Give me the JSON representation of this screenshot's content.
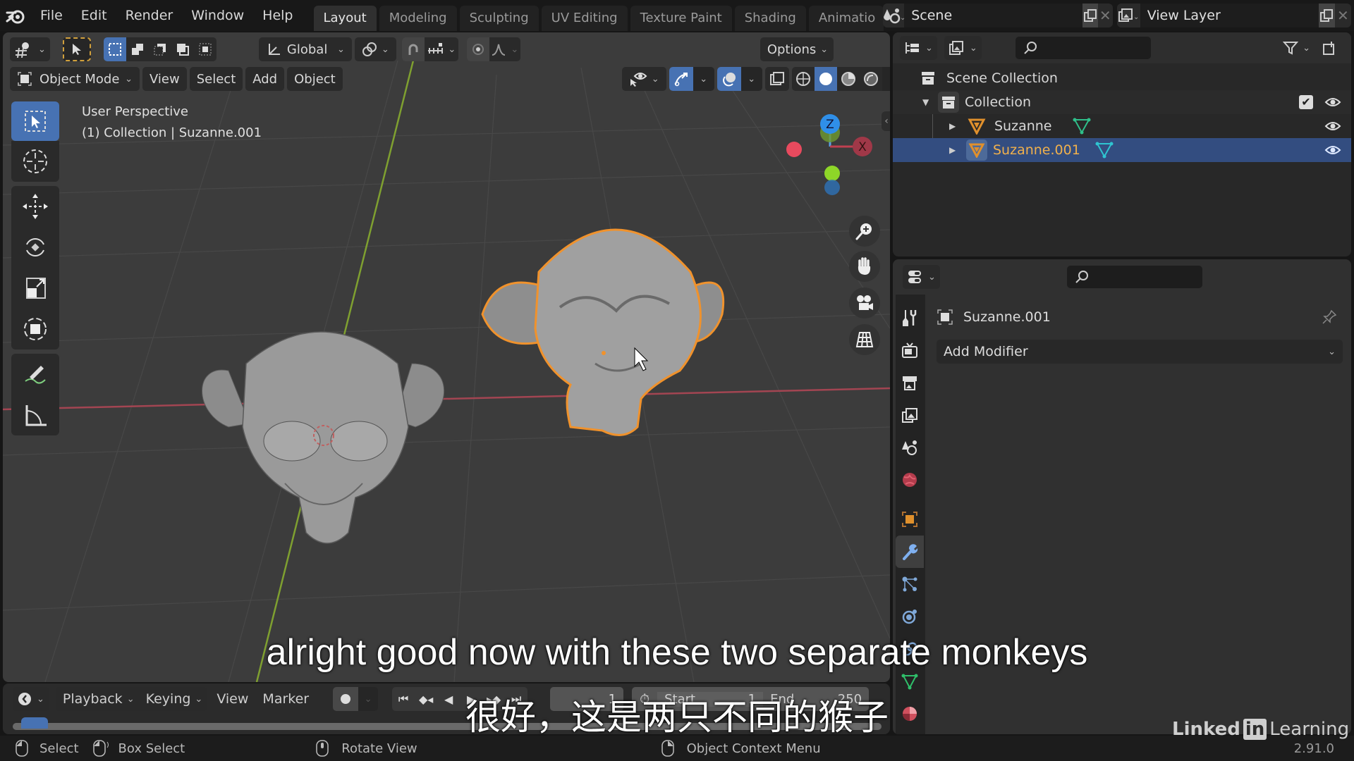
{
  "topbar": {
    "menus": [
      "File",
      "Edit",
      "Render",
      "Window",
      "Help"
    ],
    "workspace_tabs": [
      "Layout",
      "Modeling",
      "Sculpting",
      "UV Editing",
      "Texture Paint",
      "Shading",
      "Animatio"
    ],
    "active_tab": "Layout",
    "scene_name": "Scene",
    "view_layer_name": "View Layer"
  },
  "viewport": {
    "header": {
      "transform_orientation": "Global",
      "options_label": "Options",
      "mode_label": "Object Mode",
      "menus": [
        "View",
        "Select",
        "Add",
        "Object"
      ]
    },
    "overlay": {
      "perspective_label": "User Perspective",
      "context_label": "(1) Collection | Suzanne.001"
    },
    "gizmo": {
      "z": "Z",
      "x": "X"
    },
    "tools": [
      "select-box",
      "cursor",
      "move",
      "rotate",
      "scale",
      "transform",
      "annotate",
      "measure"
    ],
    "active_tool": "select-box",
    "objects": [
      {
        "name": "Suzanne",
        "selected": false
      },
      {
        "name": "Suzanne.001",
        "selected": true
      }
    ],
    "colors": {
      "selection_outline": "#f0922c",
      "x_axis": "#c04050",
      "y_axis": "#7cb030",
      "z_axis": "#3c8ee0"
    }
  },
  "timeline": {
    "menus": [
      "Playback",
      "Keying",
      "View",
      "Marker"
    ],
    "current_frame": "1",
    "start_label": "Start",
    "start_value": "1",
    "end_label": "End",
    "end_value": "250"
  },
  "statusbar": {
    "select": "Select",
    "box_select": "Box Select",
    "rotate_view": "Rotate View",
    "context_menu": "Object Context Menu",
    "version": "2.91.0"
  },
  "outliner": {
    "root": "Scene Collection",
    "collection": "Collection",
    "items": [
      {
        "name": "Suzanne",
        "selected": false
      },
      {
        "name": "Suzanne.001",
        "selected": true
      }
    ]
  },
  "properties": {
    "object_name": "Suzanne.001",
    "add_modifier_label": "Add Modifier",
    "tabs": [
      "tool",
      "render",
      "output",
      "view-layer",
      "scene",
      "world",
      "object",
      "modifiers",
      "particles",
      "physics",
      "constraints",
      "data",
      "material"
    ],
    "active_tab": "modifiers"
  },
  "subtitles": {
    "english": "alright good now with these two separate monkeys",
    "chinese": "很好，这是两只不同的猴子"
  },
  "watermark": {
    "brand_left": "Linked",
    "brand_box": "in",
    "brand_right": "Learning"
  }
}
